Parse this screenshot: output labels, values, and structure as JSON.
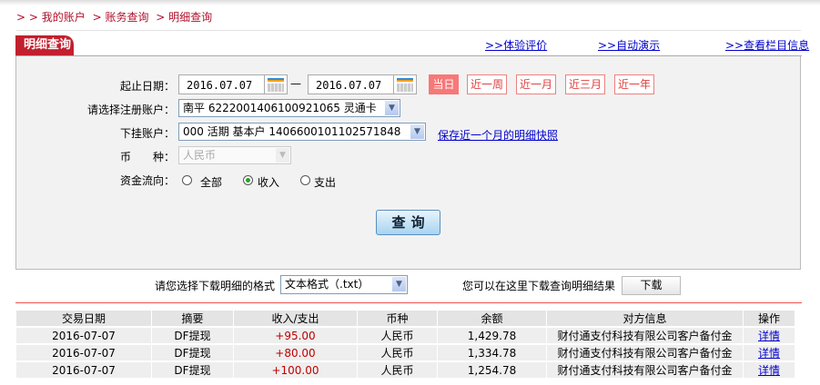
{
  "breadcrumb": [
    "> > 我的账户",
    "> 账务查询",
    "> 明细查询"
  ],
  "panel": {
    "title": "明细查询",
    "links": [
      ">>体验评价",
      ">>自动演示",
      ">>查看栏目信息"
    ]
  },
  "form": {
    "date_label": "起止日期：",
    "start_date": "2016.07.07",
    "dash": "—",
    "end_date": "2016.07.07",
    "quick": [
      "当日",
      "近一周",
      "近一月",
      "近三月",
      "近一年"
    ],
    "quick_active": "当日",
    "account_label": "请选择注册账户：",
    "account_value": "南平 6222001406100921065 灵通卡",
    "sub_label": "下挂账户：",
    "sub_value": "000 活期 基本户 1406600101102571848",
    "snapshot_link": "保存近一个月的明细快照",
    "currency_label": "币　　种：",
    "currency_value": "人民币",
    "direction_label": "资金流向：",
    "directions": [
      "全部",
      "收入",
      "支出"
    ],
    "direction_selected": "收入",
    "query_button": "查询"
  },
  "download": {
    "format_label": "请您选择下载明细的格式",
    "format_value": "文本格式（.txt）",
    "hint": "您可以在这里下载查询明细结果",
    "button": "下载"
  },
  "table": {
    "headers": [
      "交易日期",
      "摘要",
      "收入/支出",
      "币种",
      "余额",
      "对方信息",
      "操作"
    ],
    "rows": [
      [
        "2016-07-07",
        "DF提现",
        "+95.00",
        "人民币",
        "1,429.78",
        "财付通支付科技有限公司客户备付金",
        "详情"
      ],
      [
        "2016-07-07",
        "DF提现",
        "+80.00",
        "人民币",
        "1,334.78",
        "财付通支付科技有限公司客户备付金",
        "详情"
      ],
      [
        "2016-07-07",
        "DF提现",
        "+100.00",
        "人民币",
        "1,254.78",
        "财付通支付科技有限公司客户备付金",
        "详情"
      ]
    ]
  },
  "colors": {
    "brand": "#c2202e",
    "amount": "#c00000",
    "link": "#0000cc"
  }
}
